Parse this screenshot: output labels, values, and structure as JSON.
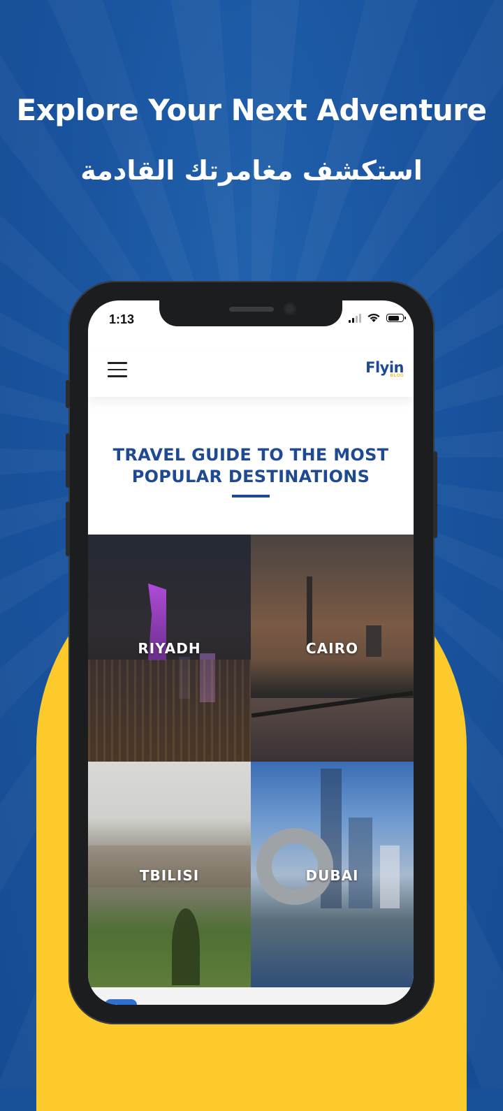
{
  "promo": {
    "headline_en": "Explore Your Next Adventure",
    "headline_ar": "استكشف مغامرتك القادمة"
  },
  "status_bar": {
    "time": "1:13"
  },
  "app_bar": {
    "menu_icon": "hamburger-menu-icon",
    "logo_text": "Flyin",
    "logo_sub": "BLOG"
  },
  "guide": {
    "title_line1": "TRAVEL GUIDE TO THE MOST",
    "title_line2": "POPULAR DESTINATIONS"
  },
  "destinations": [
    {
      "name": "RIYADH"
    },
    {
      "name": "CAIRO"
    },
    {
      "name": "TBILISI"
    },
    {
      "name": "DUBAI"
    }
  ],
  "colors": {
    "brand_blue": "#1e4a94",
    "background_blue": "#1a55a0",
    "accent_yellow": "#fcca2b"
  }
}
